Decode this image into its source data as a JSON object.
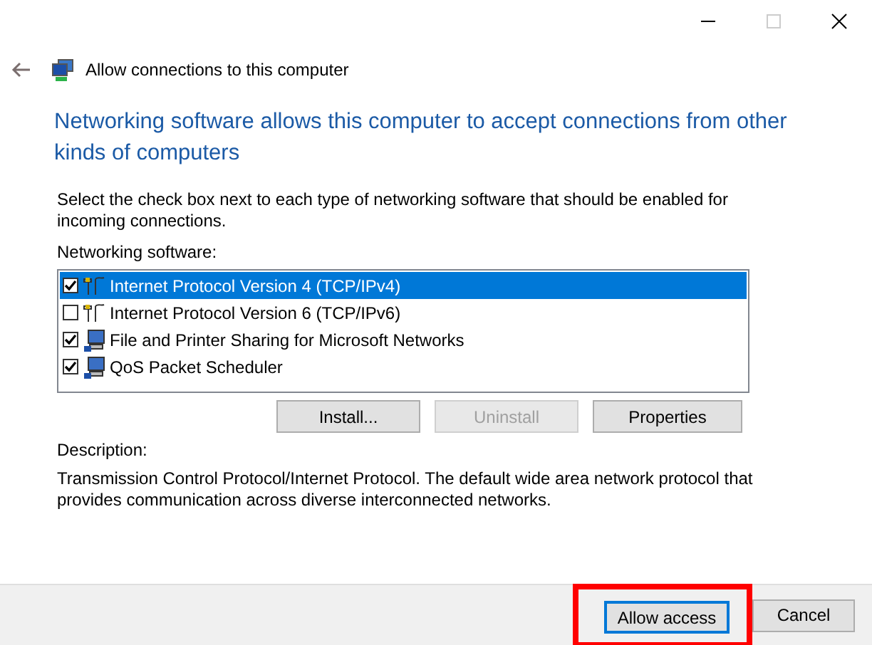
{
  "window": {
    "title": "Allow connections to this computer"
  },
  "heading": "Networking software allows this computer to accept connections from other kinds of computers",
  "instruction": "Select the check box next to each type of networking software that should be enabled for incoming connections.",
  "list_label": "Networking software:",
  "software": [
    {
      "label": "Internet Protocol Version 4 (TCP/IPv4)",
      "kind": "protocol",
      "checked": true,
      "selected": true
    },
    {
      "label": "Internet Protocol Version 6 (TCP/IPv6)",
      "kind": "protocol",
      "checked": false,
      "selected": false
    },
    {
      "label": "File and Printer Sharing for Microsoft Networks",
      "kind": "service",
      "checked": true,
      "selected": false
    },
    {
      "label": "QoS Packet Scheduler",
      "kind": "service",
      "checked": true,
      "selected": false
    }
  ],
  "list_buttons": [
    {
      "label": "Install...",
      "disabled": false
    },
    {
      "label": "Uninstall",
      "disabled": true
    },
    {
      "label": "Properties",
      "disabled": false
    }
  ],
  "description_label": "Description:",
  "description": "Transmission Control Protocol/Internet Protocol. The default wide area network protocol that provides communication across diverse interconnected networks.",
  "footer_buttons": [
    {
      "label": "Allow access",
      "default": true,
      "highlighted": true
    },
    {
      "label": "Cancel",
      "default": false,
      "highlighted": false
    }
  ]
}
